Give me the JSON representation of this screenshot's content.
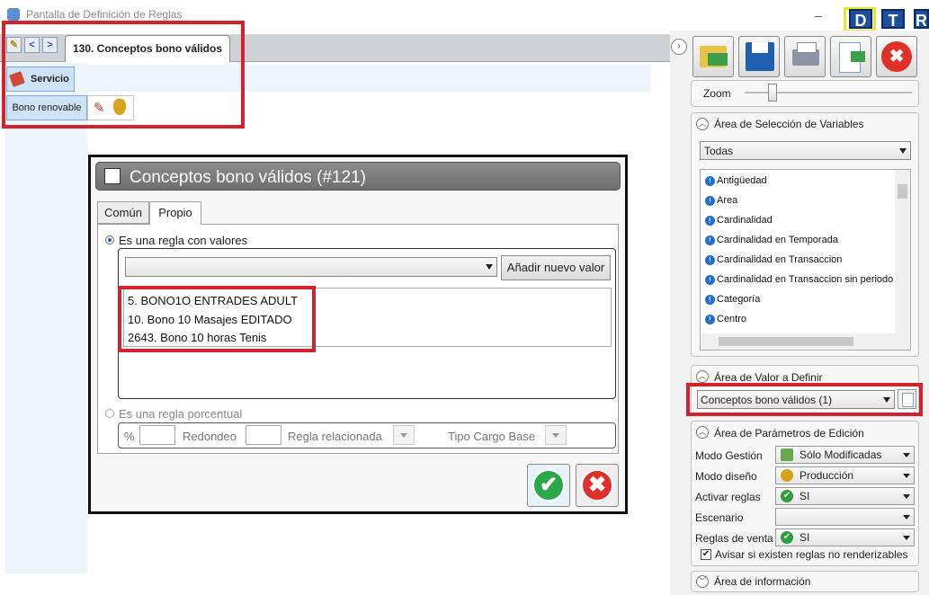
{
  "window": {
    "title": "Pantalla de Definición de Reglas",
    "minimize_symbol": "_",
    "corner_buttons": [
      "D",
      "T",
      "R"
    ]
  },
  "tabs": {
    "nav_icons": [
      "new-rule-icon",
      "back-arrow-icon",
      "forward-arrow-icon"
    ],
    "active_tab": "130. Conceptos bono válidos"
  },
  "left_panel": {
    "service_button": "Servicio",
    "bono_button": "Bono renovable"
  },
  "dialog": {
    "title": "Conceptos bono válidos (#121)",
    "tabs": [
      "Común",
      "Propio"
    ],
    "active_tab": "Propio",
    "radio_values": "Es una regla con valores",
    "radio_values_selected": true,
    "add_button": "Añadir nuevo valor",
    "values_combo": "",
    "values": [
      "5. BONO1O ENTRADES ADULT",
      "10. Bono 10 Masajes EDITADO",
      "2643. Bono 10 horas Tenis"
    ],
    "radio_percent": "Es una regla porcentual",
    "radio_percent_selected": false,
    "percent_label": "%",
    "redondeo_label": "Redondeo",
    "regla_relacionada_label": "Regla relacionada",
    "tipo_cargo_label": "Tipo Cargo Base",
    "ok_symbol": "✔",
    "cancel_symbol": "✖"
  },
  "right_panel": {
    "toolbar": [
      "open-folder-icon",
      "save-icon",
      "print-icon",
      "export-icon",
      "close-icon"
    ],
    "zoom_label": "Zoom",
    "zoom_value": 0.14,
    "var_section_title": "Área de Selección de Variables",
    "var_filter": "Todas",
    "variables": [
      "Antigüedad",
      "Area",
      "Cardinalidad",
      "Cardinalidad en Temporada",
      "Cardinalidad en Transaccion",
      "Cardinalidad en Transaccion sin periodo",
      "Categoría",
      "Centro"
    ],
    "value_section_title": "Área de Valor a Definir",
    "value_combo": "Conceptos bono válidos (1)",
    "params_section_title": "Área de Parámetros de Edición",
    "params": [
      {
        "label": "Modo Gestión",
        "value": "Sólo Modificadas",
        "icon": "books-icon",
        "color": "#6aa84f"
      },
      {
        "label": "Modo diseño",
        "value": "Producción",
        "icon": "money-bag-icon",
        "color": "#d9a21b"
      },
      {
        "label": "Activar reglas",
        "value": "SI",
        "icon": "check-icon",
        "color": "#2e9e3a"
      },
      {
        "label": "Escenario",
        "value": "",
        "icon": "",
        "color": ""
      },
      {
        "label": "Reglas de venta",
        "value": "SI",
        "icon": "check-icon",
        "color": "#2e9e3a"
      }
    ],
    "checkbox_label": "Avisar si existen reglas no renderizables",
    "checkbox_checked": true,
    "info_section_title": "Área de información"
  },
  "colors": {
    "highlight_red": "#d3222c",
    "accent_blue": "#1d4e9c",
    "ok_green": "#2aa84a",
    "cancel_red": "#e0302a"
  }
}
